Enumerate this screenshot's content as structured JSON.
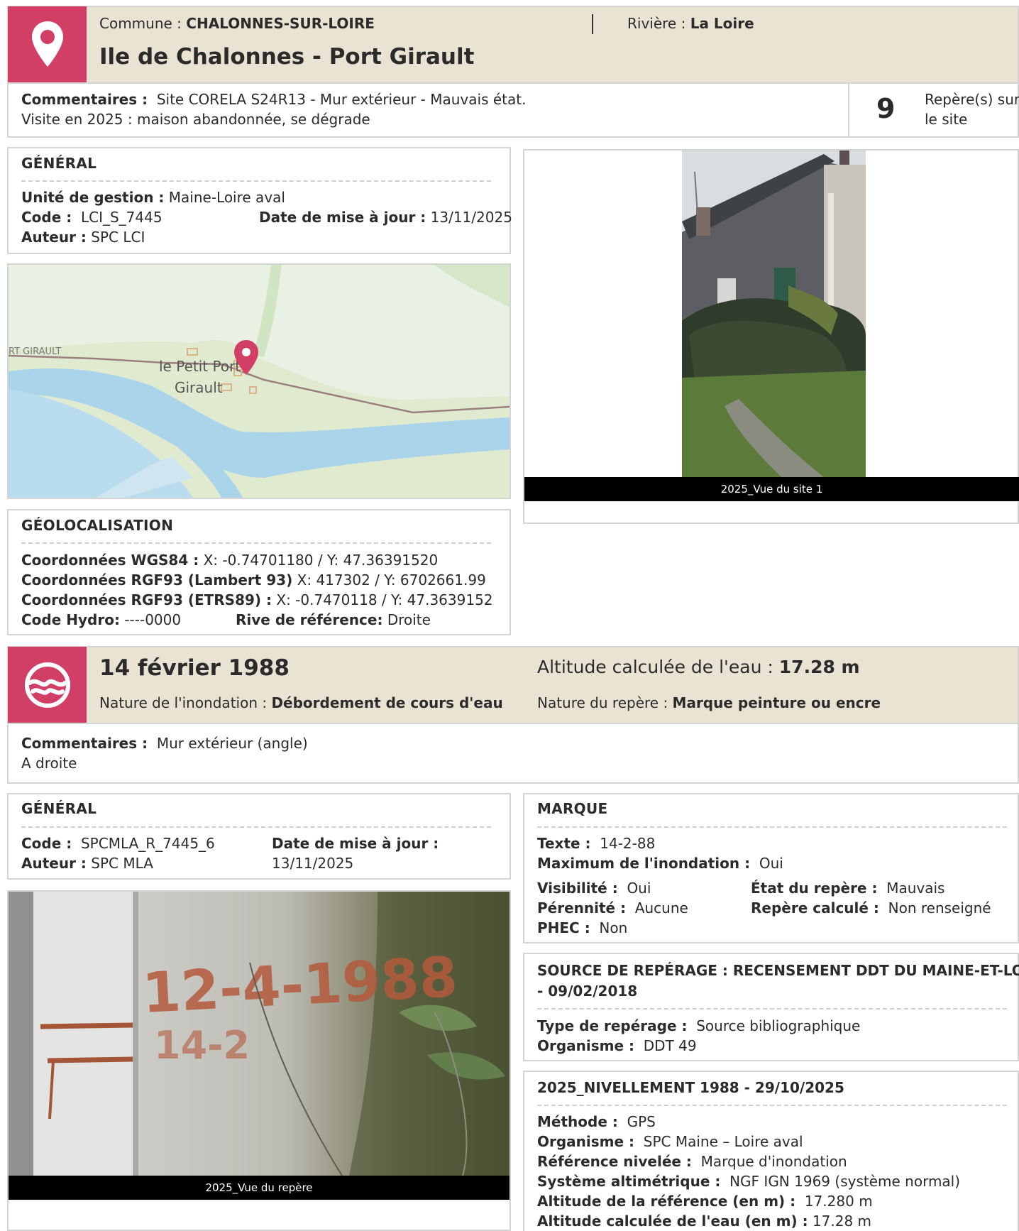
{
  "site": {
    "commune_label": "Commune :",
    "commune": "CHALONNES-SUR-LOIRE",
    "riviere_label": "Rivière :",
    "riviere": "La Loire",
    "title": "Ile de Chalonnes - Port Girault",
    "comments_label": "Commentaires :",
    "comments_line1": "Site CORELA S24R13 - Mur extérieur - Mauvais état.",
    "comments_line2": "Visite en 2025 : maison abandonnée, se dégrade",
    "count": "9",
    "count_label_line1": "Repère(s) sur",
    "count_label_line2": "le site"
  },
  "general": {
    "title": "GÉNÉRAL",
    "unite_label": "Unité de gestion :",
    "unite": "Maine-Loire aval",
    "code_label": "Code :",
    "code": "LCI_S_7445",
    "date_label": "Date de mise à jour :",
    "date": "13/11/2025",
    "auteur_label": "Auteur :",
    "auteur": "SPC LCI"
  },
  "map": {
    "label_port_girault": "RT GIRAULT",
    "label_petit_port": "le Petit Port",
    "label_girault": "Girault",
    "colors": {
      "land": "#e7efe2",
      "green": "#d4e6c7",
      "water": "#a8d3e8",
      "road": "#9b7f7f",
      "pin": "#d13f66"
    }
  },
  "site_photo": {
    "caption": "2025_Vue du site 1"
  },
  "geo": {
    "title": "GÉOLOCALISATION",
    "wgs_label": "Coordonnées WGS84 :",
    "wgs": "X: -0.74701180 / Y: 47.36391520",
    "lambert_label": "Coordonnées RGF93 (Lambert 93)",
    "lambert": "X: 417302 / Y: 6702661.99",
    "etrs_label": "Coordonnées RGF93 (ETRS89) :",
    "etrs": "X: -0.7470118 / Y: 47.3639152",
    "hydro_label": "Code Hydro:",
    "hydro": "----0000",
    "rive_label": "Rive de référence:",
    "rive": "Droite"
  },
  "event": {
    "date": "14 février 1988",
    "altitude_label": "Altitude calculée de l'eau :",
    "altitude": "17.28 m",
    "nature_label": "Nature de l'inondation :",
    "nature": "Débordement de cours d'eau",
    "repere_label": "Nature du repère :",
    "repere": "Marque peinture ou encre",
    "comments_label": "Commentaires :",
    "comments_line1": "Mur extérieur (angle)",
    "comments_line2": "A droite"
  },
  "general2": {
    "title": "GÉNÉRAL",
    "code_label": "Code :",
    "code": "SPCMLA_R_7445_6",
    "date_label": "Date de mise à jour :",
    "date": "13/11/2025",
    "auteur_label": "Auteur :",
    "auteur": "SPC MLA"
  },
  "marque": {
    "title": "MARQUE",
    "texte_label": "Texte :",
    "texte": "14-2-88",
    "max_label": "Maximum de l'inondation :",
    "max": "Oui",
    "visibilite_label": "Visibilité :",
    "visibilite": "Oui",
    "etat_label": "État du repère :",
    "etat": "Mauvais",
    "perennite_label": "Pérennité :",
    "perennite": "Aucune",
    "calcule_label": "Repère calculé :",
    "calcule": "Non renseigné",
    "phec_label": "PHEC :",
    "phec": "Non"
  },
  "source": {
    "title_line1": "SOURCE DE REPÉRAGE : RECENSEMENT DDT DU MAINE-ET-LOIRE",
    "title_line2": "- 09/02/2018",
    "type_label": "Type de repérage :",
    "type": "Source bibliographique",
    "org_label": "Organisme :",
    "org": "DDT 49"
  },
  "niv": {
    "title": "2025_NIVELLEMENT 1988 - 29/10/2025",
    "methode_label": "Méthode :",
    "methode": "GPS",
    "org_label": "Organisme :",
    "org": "SPC Maine – Loire aval",
    "ref_label": "Référence nivelée :",
    "ref": "Marque d'inondation",
    "sys_label": "Système altimétrique :",
    "sys": "NGF IGN 1969 (système normal)",
    "alt_ref_label": "Altitude de la référence (en m) :",
    "alt_ref": "17.280 m",
    "alt_eau_label": "Altitude calculée de l'eau (en m) :",
    "alt_eau": "17.28 m"
  },
  "mark_photo": {
    "caption": "2025_Vue du repère",
    "painted_top": "12-4-1988",
    "painted_bottom": "14-2"
  }
}
